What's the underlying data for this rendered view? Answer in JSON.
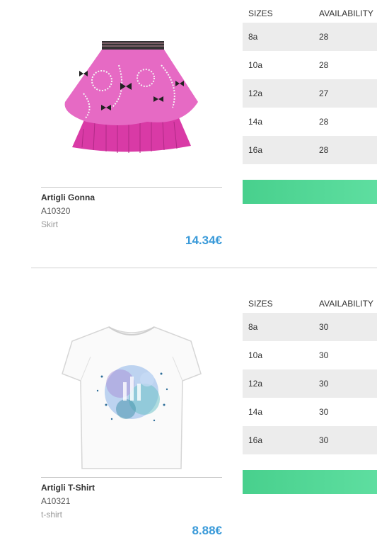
{
  "products": [
    {
      "name": "Artigli Gonna",
      "code": "A10320",
      "type": "Skirt",
      "price": "14.34€",
      "image": "pink-layered-skirt",
      "table": {
        "headers": [
          "SIZES",
          "AVAILABILITY"
        ],
        "rows": [
          {
            "size": "8a",
            "availability": "28"
          },
          {
            "size": "10a",
            "availability": "28"
          },
          {
            "size": "12a",
            "availability": "27"
          },
          {
            "size": "14a",
            "availability": "28"
          },
          {
            "size": "16a",
            "availability": "28"
          }
        ]
      }
    },
    {
      "name": "Artigli T-Shirt",
      "code": "A10321",
      "type": "t-shirt",
      "price": "8.88€",
      "image": "white-tshirt-with-print",
      "table": {
        "headers": [
          "SIZES",
          "AVAILABILITY"
        ],
        "rows": [
          {
            "size": "8a",
            "availability": "30"
          },
          {
            "size": "10a",
            "availability": "30"
          },
          {
            "size": "12a",
            "availability": "30"
          },
          {
            "size": "14a",
            "availability": "30"
          },
          {
            "size": "16a",
            "availability": "30"
          }
        ]
      }
    }
  ],
  "colors": {
    "price": "#3a9ad9",
    "button": "#48d08d",
    "row_alt": "#ececec"
  }
}
